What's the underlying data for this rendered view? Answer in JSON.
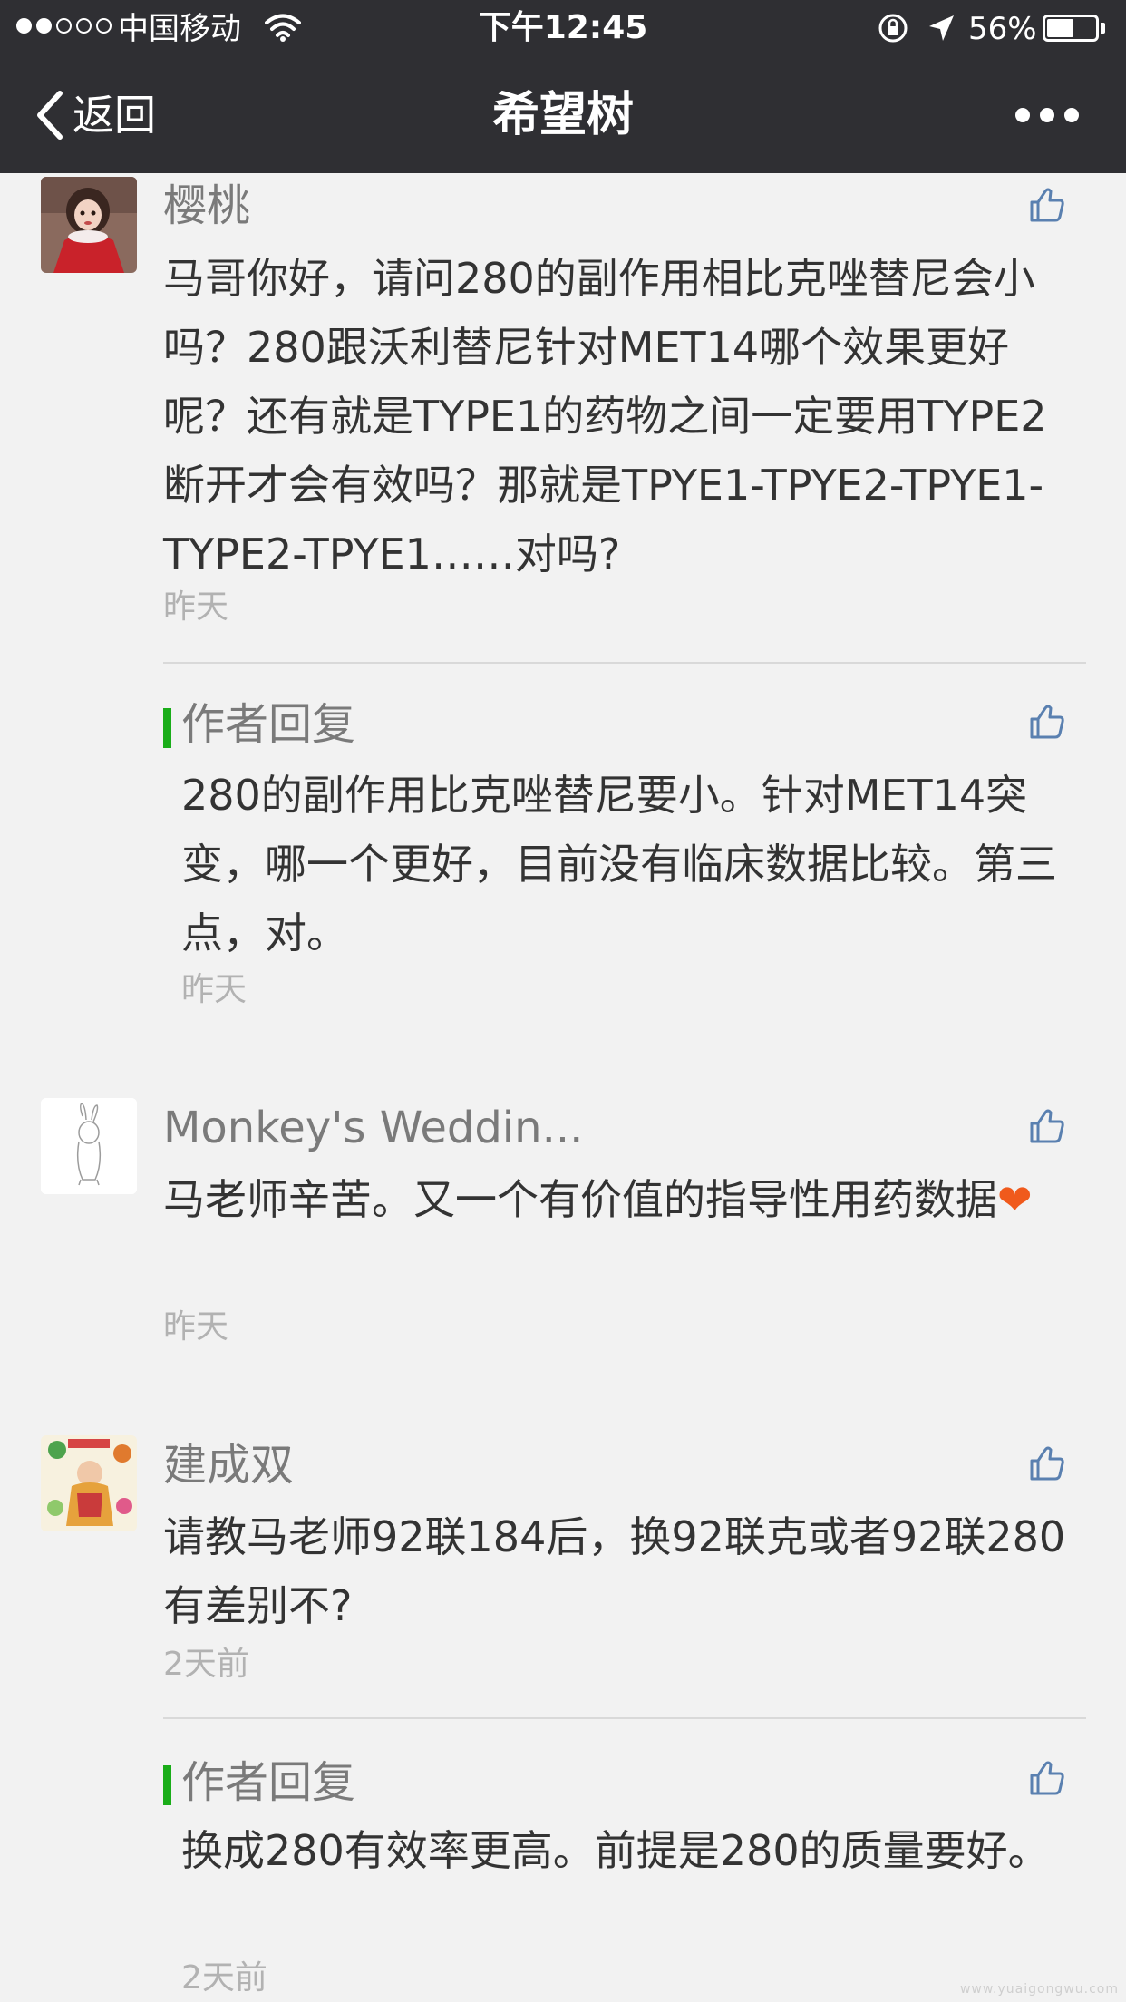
{
  "status_bar": {
    "carrier": "中国移动",
    "time": "下午12:45",
    "battery": "56%",
    "battery_level": 0.56
  },
  "nav": {
    "back_label": "返回",
    "title": "希望树"
  },
  "comments": [
    {
      "author": "樱桃",
      "text": "马哥你好，请问280的副作用相比克唑替尼会小吗？280跟沃利替尼针对MET14哪个效果更好呢？还有就是TYPE1的药物之间一定要用TYPE2断开才会有效吗？那就是TPYE1-TPYE2-TPYE1-TYPE2-TPYE1……对吗?",
      "time": "昨天",
      "reply": {
        "label": "作者回复",
        "text": "280的副作用比克唑替尼要小。针对MET14突变，哪一个更好，目前没有临床数据比较。第三点，对。",
        "time": "昨天"
      }
    },
    {
      "author": "Monkey's Weddin...",
      "text": "马老师辛苦。又一个有价值的指导性用药数据",
      "emoji": "❤",
      "time": "昨天"
    },
    {
      "author": "建成双",
      "text": "请教马老师92联184后，换92联克或者92联280有差别不?",
      "time": "2天前",
      "reply": {
        "label": "作者回复",
        "text": "换成280有效率更高。前提是280的质量要好。",
        "time": "2天前"
      }
    }
  ],
  "watermark": "www.yuaigongwu.com"
}
